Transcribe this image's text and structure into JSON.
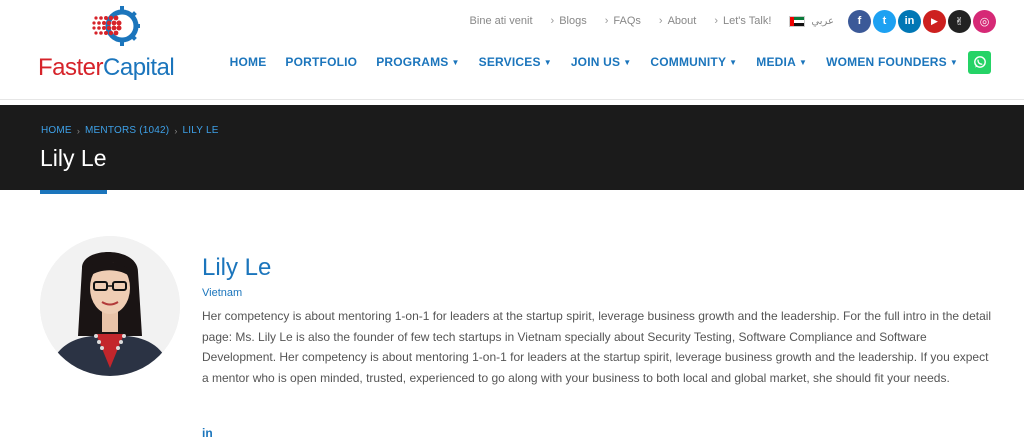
{
  "logo": {
    "part1": "Faster",
    "part2": "Capital"
  },
  "topbar": {
    "links": [
      {
        "label": "Bine ati venit",
        "chevron": false
      },
      {
        "label": "Blogs",
        "chevron": true
      },
      {
        "label": "FAQs",
        "chevron": true
      },
      {
        "label": "About",
        "chevron": true
      },
      {
        "label": "Let's Talk!",
        "chevron": true
      }
    ],
    "language": "عربي",
    "socials": [
      {
        "name": "facebook-icon",
        "glyph": "f",
        "color": "#3b5998"
      },
      {
        "name": "twitter-icon",
        "glyph": "t",
        "color": "#1da1f2"
      },
      {
        "name": "linkedin-icon",
        "glyph": "in",
        "color": "#0077b5"
      },
      {
        "name": "youtube-icon",
        "glyph": "▶",
        "color": "#cd201f"
      },
      {
        "name": "angellist-icon",
        "glyph": "✌",
        "color": "#222222"
      },
      {
        "name": "instagram-icon",
        "glyph": "◎",
        "color": "#d62976"
      }
    ]
  },
  "nav": {
    "items": [
      {
        "label": "HOME",
        "dropdown": false
      },
      {
        "label": "PORTFOLIO",
        "dropdown": false
      },
      {
        "label": "PROGRAMS",
        "dropdown": true
      },
      {
        "label": "SERVICES",
        "dropdown": true
      },
      {
        "label": "JOIN US",
        "dropdown": true
      },
      {
        "label": "COMMUNITY",
        "dropdown": true
      },
      {
        "label": "MEDIA",
        "dropdown": true
      },
      {
        "label": "WOMEN FOUNDERS",
        "dropdown": true
      }
    ]
  },
  "breadcrumb": {
    "home": "HOME",
    "mentors": "MENTORS (1042)",
    "current": "LILY LE"
  },
  "page": {
    "title": "Lily Le"
  },
  "profile": {
    "name": "Lily Le",
    "country": "Vietnam",
    "bio": "Her competency is about mentoring 1-on-1 for leaders at the startup spirit, leverage business growth and the leadership. For the full intro in the detail page: Ms. Lily Le is also the founder of few tech startups in Vietnam specially about Security Testing, Software Compliance and Software Development. Her competency is about mentoring 1-on-1 for leaders at the startup spirit, leverage business growth and the leadership. If you expect a mentor who is open minded, trusted, experienced to go along with your business to both local and global market, she should fit your needs.",
    "linkedin_glyph": "in"
  },
  "colors": {
    "brand_blue": "#1b75bc",
    "brand_red": "#d6232a",
    "banner_bg": "#1b1b1b",
    "whatsapp": "#25d366"
  }
}
